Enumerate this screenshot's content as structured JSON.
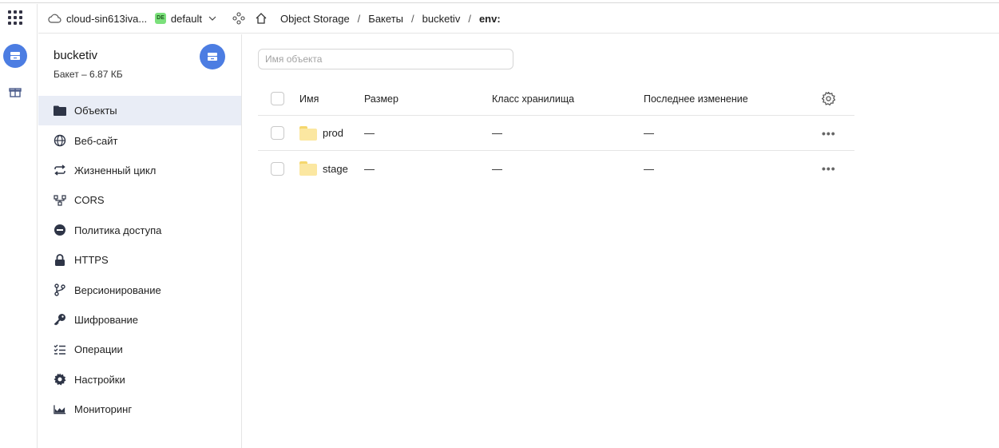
{
  "header": {
    "cloud_label": "cloud-sin613iva...",
    "folder_badge": "DE",
    "folder_label": "default",
    "breadcrumbs": [
      "Object Storage",
      "Бакеты",
      "bucketiv",
      "env:"
    ]
  },
  "sidebar": {
    "bucket_name": "bucketiv",
    "bucket_info": "Бакет – 6.87 КБ",
    "items": [
      {
        "label": "Объекты",
        "icon": "folder-icon",
        "active": true
      },
      {
        "label": "Веб-сайт",
        "icon": "globe-icon"
      },
      {
        "label": "Жизненный цикл",
        "icon": "cycle-icon"
      },
      {
        "label": "CORS",
        "icon": "cors-icon"
      },
      {
        "label": "Политика доступа",
        "icon": "minus-circle-icon"
      },
      {
        "label": "HTTPS",
        "icon": "lock-icon"
      },
      {
        "label": "Версионирование",
        "icon": "branch-icon"
      },
      {
        "label": "Шифрование",
        "icon": "key-icon"
      },
      {
        "label": "Операции",
        "icon": "checklist-icon"
      },
      {
        "label": "Настройки",
        "icon": "gear-icon"
      },
      {
        "label": "Мониторинг",
        "icon": "chart-icon"
      }
    ]
  },
  "main": {
    "search_placeholder": "Имя объекта",
    "columns": {
      "name": "Имя",
      "size": "Размер",
      "class": "Класс хранилища",
      "modified": "Последнее изменение"
    },
    "rows": [
      {
        "name": "prod",
        "size": "—",
        "class": "—",
        "modified": "—",
        "actions": "•••"
      },
      {
        "name": "stage",
        "size": "—",
        "class": "—",
        "modified": "—",
        "actions": "•••"
      }
    ]
  },
  "colors": {
    "accent": "#4c7de2",
    "active_nav_bg": "#e9edf6",
    "folder": "#fbe7a1",
    "badge": "#7be07b"
  }
}
